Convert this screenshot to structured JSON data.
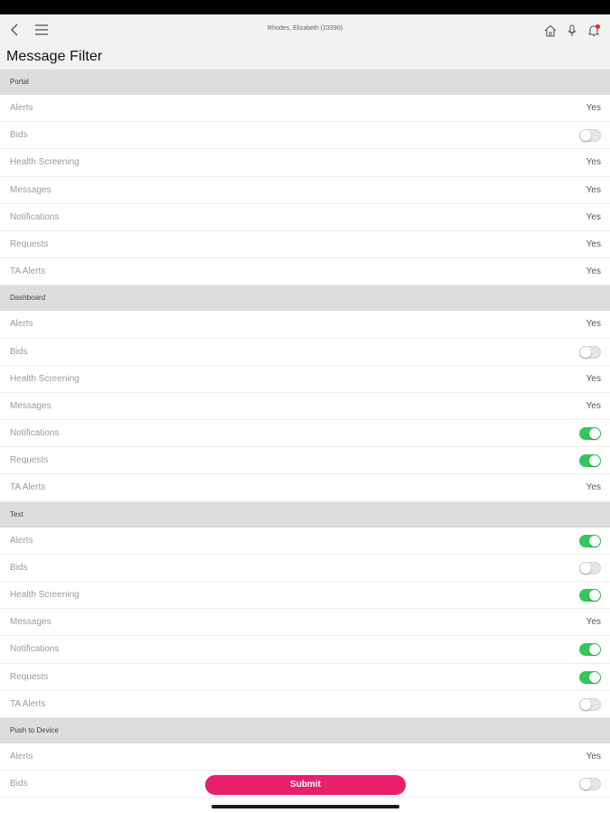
{
  "header": {
    "user": "Rhodes, Elizabeth (23390)",
    "title": "Message Filter"
  },
  "sections": [
    {
      "name": "Portal",
      "rows": [
        {
          "label": "Alerts",
          "kind": "text",
          "value": "Yes"
        },
        {
          "label": "Bids",
          "kind": "toggle",
          "on": false
        },
        {
          "label": "Health Screening",
          "kind": "text",
          "value": "Yes"
        },
        {
          "label": "Messages",
          "kind": "text",
          "value": "Yes"
        },
        {
          "label": "Notifications",
          "kind": "text",
          "value": "Yes"
        },
        {
          "label": "Requests",
          "kind": "text",
          "value": "Yes"
        },
        {
          "label": "TA Alerts",
          "kind": "text",
          "value": "Yes"
        }
      ]
    },
    {
      "name": "Dashboard",
      "rows": [
        {
          "label": "Alerts",
          "kind": "text",
          "value": "Yes"
        },
        {
          "label": "Bids",
          "kind": "toggle",
          "on": false
        },
        {
          "label": "Health Screening",
          "kind": "text",
          "value": "Yes"
        },
        {
          "label": "Messages",
          "kind": "text",
          "value": "Yes"
        },
        {
          "label": "Notifications",
          "kind": "toggle",
          "on": true
        },
        {
          "label": "Requests",
          "kind": "toggle",
          "on": true
        },
        {
          "label": "TA Alerts",
          "kind": "text",
          "value": "Yes"
        }
      ]
    },
    {
      "name": "Text",
      "rows": [
        {
          "label": "Alerts",
          "kind": "toggle",
          "on": true
        },
        {
          "label": "Bids",
          "kind": "toggle",
          "on": false
        },
        {
          "label": "Health Screening",
          "kind": "toggle",
          "on": true
        },
        {
          "label": "Messages",
          "kind": "text",
          "value": "Yes"
        },
        {
          "label": "Notifications",
          "kind": "toggle",
          "on": true
        },
        {
          "label": "Requests",
          "kind": "toggle",
          "on": true
        },
        {
          "label": "TA Alerts",
          "kind": "toggle",
          "on": false
        }
      ]
    },
    {
      "name": "Push to Device",
      "rows": [
        {
          "label": "Alerts",
          "kind": "text",
          "value": "Yes"
        },
        {
          "label": "Bids",
          "kind": "toggle",
          "on": false
        }
      ]
    }
  ],
  "submit_label": "Submit",
  "colors": {
    "accent": "#e81f6b",
    "toggle_on": "#34c759",
    "section_bg": "#dddddd",
    "notification_dot": "#e8251f"
  },
  "icons": [
    "back-icon",
    "menu-icon",
    "home-icon",
    "microphone-icon",
    "bell-icon"
  ]
}
